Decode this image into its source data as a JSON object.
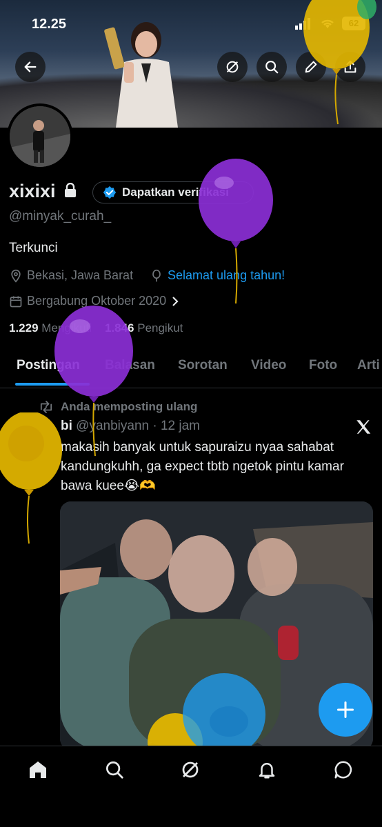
{
  "status_bar": {
    "time": "12.25",
    "battery": "62"
  },
  "profile": {
    "name": "xixixi",
    "verify_label": "Dapatkan verifikasi",
    "handle": "@minyak_curah_",
    "bio": "Terkunci",
    "location": "Bekasi, Jawa Barat",
    "birthday_link": "Selamat ulang tahun!",
    "joined": "Bergabung Oktober 2020",
    "following_count": "1.229",
    "following_label": "Mengikuti",
    "followers_count": "1.846",
    "followers_label": "Pengikut"
  },
  "tabs": [
    {
      "label": "Postingan",
      "active": true
    },
    {
      "label": "Balasan"
    },
    {
      "label": "Sorotan"
    },
    {
      "label": "Video"
    },
    {
      "label": "Foto"
    },
    {
      "label": "Arti"
    }
  ],
  "post": {
    "repost_label": "Anda memposting ulang",
    "author_name": "bi",
    "author_handle": "@yanbiyann",
    "time": "· 12 jam",
    "text": "makasih banyak untuk sapuraizu nyaa sahabat kandungkuhh, ga expect tbtb ngetok pintu kamar bawa kuee😭🫶"
  },
  "icons": {
    "back": "back-arrow-icon",
    "grok": "grok-icon",
    "search": "search-icon",
    "edit": "pencil-icon",
    "share": "share-icon",
    "lock": "lock-icon",
    "verified": "verified-badge-icon",
    "location": "location-pin-icon",
    "balloon": "balloon-icon",
    "calendar": "calendar-icon",
    "chevron": "chevron-right-icon",
    "repost": "repost-icon",
    "x_logo": "x-logo-icon",
    "compose": "plus-icon",
    "home": "home-icon",
    "notifications": "bell-icon",
    "messages": "message-icon"
  },
  "colors": {
    "accent": "#1d9bf0",
    "background": "#000000",
    "muted": "#71767b",
    "balloon_purple": "#8b2fd6",
    "balloon_gold": "#e6b800"
  }
}
